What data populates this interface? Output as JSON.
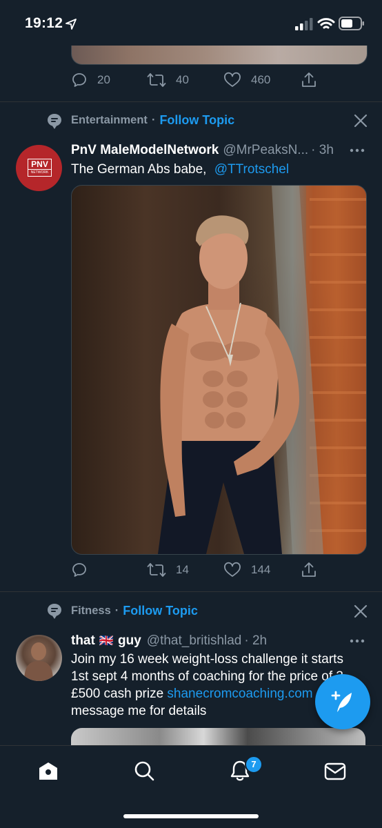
{
  "status_bar": {
    "time": "19:12"
  },
  "previous_tweet": {
    "replies": "20",
    "retweets": "40",
    "likes": "460"
  },
  "tweet1": {
    "topic": "Entertainment",
    "topic_separator": "·",
    "follow_topic": "Follow Topic",
    "avatar_text": "PNV",
    "avatar_subtext": "NETWORK",
    "display_name": "PnV MaleModelNetwork",
    "handle": "@MrPeaksN...",
    "time": "· 3h",
    "text": "The German Abs babe,",
    "mention": "@TTrotschel",
    "replies": "",
    "retweets": "14",
    "likes": "144"
  },
  "tweet2": {
    "topic": "Fitness",
    "topic_separator": "·",
    "follow_topic": "Follow Topic",
    "display_name_part1": "that",
    "flag_emoji": "🇬🇧",
    "display_name_part2": "guy",
    "handle": "@that_britishlad",
    "time": "· 2h",
    "text_line1": "Join my 16 week weight-loss challenge it starts",
    "text_line2": "1st sept 4 months of coaching for the price of 3",
    "text_line3_prefix": "£500 cash prize ",
    "link": "shanecromcoaching.com",
    "text_line4": "message me for details"
  },
  "tabbar": {
    "notifications_badge": "7"
  },
  "colors": {
    "background": "#15202b",
    "accent": "#1d9bf0",
    "muted": "#8b98a5"
  },
  "icons": [
    "location-arrow-icon",
    "signal-icon",
    "wifi-icon",
    "battery-icon",
    "reply-icon",
    "retweet-icon",
    "like-icon",
    "share-icon",
    "topic-icon",
    "close-icon",
    "more-icon",
    "compose-icon",
    "home-icon",
    "search-icon",
    "notifications-icon",
    "messages-icon"
  ]
}
